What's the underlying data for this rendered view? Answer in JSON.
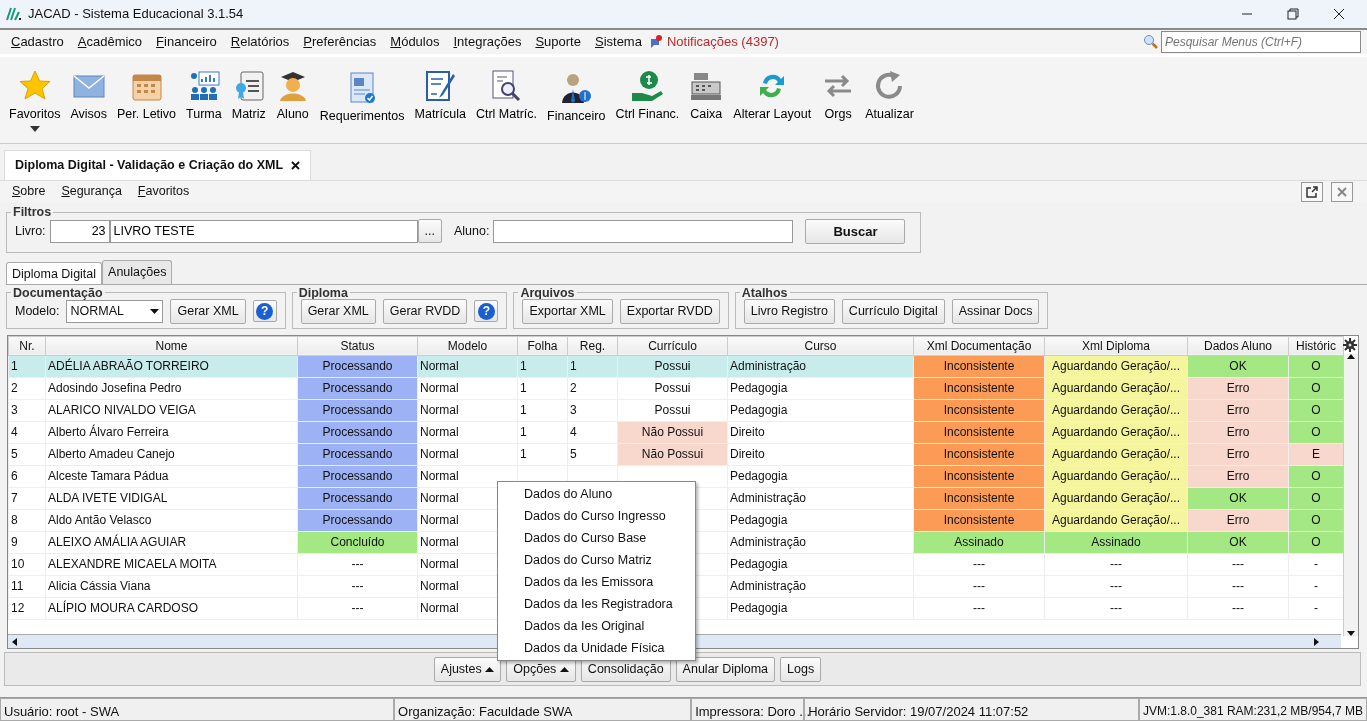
{
  "window": {
    "title": "JACAD - Sistema Educacional 3.1.54"
  },
  "menu": [
    "Cadastro",
    "Acadêmico",
    "Financeiro",
    "Relatórios",
    "Preferências",
    "Módulos",
    "Integrações",
    "Suporte",
    "Sistema"
  ],
  "notifications": "Notificações (4397)",
  "menu_search": {
    "placeholder": "Pesquisar Menus (Ctrl+F)"
  },
  "toolbar": [
    {
      "label": "Favoritos",
      "dropdown": true
    },
    {
      "label": "Avisos",
      "dropdown": false
    },
    {
      "label": "Per. Letivo",
      "dropdown": false
    },
    {
      "label": "Turma",
      "dropdown": false
    },
    {
      "label": "Matriz",
      "dropdown": false
    },
    {
      "label": "Aluno",
      "dropdown": false
    },
    {
      "label": "Requerimentos",
      "dropdown": false
    },
    {
      "label": "Matrícula",
      "dropdown": false
    },
    {
      "label": "Ctrl Matríc.",
      "dropdown": false
    },
    {
      "label": "Financeiro",
      "dropdown": false
    },
    {
      "label": "Ctrl Financ.",
      "dropdown": false
    },
    {
      "label": "Caixa",
      "dropdown": false
    },
    {
      "label": "Alterar Layout",
      "dropdown": false
    },
    {
      "label": "Orgs",
      "dropdown": false
    },
    {
      "label": "Atualizar",
      "dropdown": false
    }
  ],
  "document_tab": {
    "title": "Diploma Digital - Validação e Criação do XML"
  },
  "screen_menu": [
    "Sobre",
    "Segurança",
    "Favoritos"
  ],
  "filters": {
    "title": "Filtros",
    "livro_label": "Livro:",
    "livro_code": "23",
    "livro_name": "LIVRO TESTE",
    "browse_button": "...",
    "aluno_label": "Aluno:",
    "search_button": "Buscar"
  },
  "tabs": [
    {
      "label": "Diploma Digital",
      "selected": true
    },
    {
      "label": "Anulações",
      "selected": false
    }
  ],
  "groups": [
    {
      "title": "Documentação",
      "model_label": "Modelo:",
      "model_value": "NORMAL",
      "buttons": [
        "Gerar XML"
      ],
      "help": "?"
    },
    {
      "title": "Diploma",
      "buttons": [
        "Gerar XML",
        "Gerar RVDD"
      ],
      "help": "?"
    },
    {
      "title": "Arquivos",
      "buttons": [
        "Exportar XML",
        "Exportar RVDD"
      ]
    },
    {
      "title": "Atalhos",
      "buttons": [
        "Livro Registro",
        "Currículo Digital",
        "Assinar Docs"
      ]
    }
  ],
  "table": {
    "columns": [
      "Nr.",
      "Nome",
      "Status",
      "Modelo",
      "Folha",
      "Reg.",
      "Currículo",
      "Curso",
      "Xml Documentação",
      "Xml Diploma",
      "Dados Aluno",
      "Históric"
    ],
    "rows": [
      {
        "selected": true,
        "cells": [
          {
            "text": "1"
          },
          {
            "text": "ADÉLIA ABRAÃO TORREIRO"
          },
          {
            "text": "Processando",
            "color": "#9db2f4"
          },
          {
            "text": "Normal"
          },
          {
            "text": "1"
          },
          {
            "text": "1"
          },
          {
            "text": "Possui"
          },
          {
            "text": "Administração"
          },
          {
            "text": "Inconsistente",
            "color": "#fb9b55"
          },
          {
            "text": "Aguardando Geração/...",
            "color": "#f4f59c"
          },
          {
            "text": "OK",
            "color": "#a3e882"
          },
          {
            "text": "O",
            "color": "#a3e882"
          }
        ]
      },
      {
        "selected": false,
        "cells": [
          {
            "text": "2"
          },
          {
            "text": "Adosindo Josefina Pedro"
          },
          {
            "text": "Processando",
            "color": "#9db2f4"
          },
          {
            "text": "Normal"
          },
          {
            "text": "1"
          },
          {
            "text": "2"
          },
          {
            "text": "Possui"
          },
          {
            "text": "Pedagogia"
          },
          {
            "text": "Inconsistente",
            "color": "#fb9b55"
          },
          {
            "text": "Aguardando Geração/...",
            "color": "#f4f59c"
          },
          {
            "text": "Erro",
            "color": "#f8d7cd"
          },
          {
            "text": "O",
            "color": "#a3e882"
          }
        ]
      },
      {
        "selected": false,
        "cells": [
          {
            "text": "3"
          },
          {
            "text": "ALARICO NIVALDO VEIGA"
          },
          {
            "text": "Processando",
            "color": "#9db2f4"
          },
          {
            "text": "Normal"
          },
          {
            "text": "1"
          },
          {
            "text": "3"
          },
          {
            "text": "Possui"
          },
          {
            "text": "Pedagogia"
          },
          {
            "text": "Inconsistente",
            "color": "#fb9b55"
          },
          {
            "text": "Aguardando Geração/...",
            "color": "#f4f59c"
          },
          {
            "text": "Erro",
            "color": "#f8d7cd"
          },
          {
            "text": "O",
            "color": "#a3e882"
          }
        ]
      },
      {
        "selected": false,
        "cells": [
          {
            "text": "4"
          },
          {
            "text": "Alberto Álvaro Ferreira"
          },
          {
            "text": "Processando",
            "color": "#9db2f4"
          },
          {
            "text": "Normal"
          },
          {
            "text": "1"
          },
          {
            "text": "4"
          },
          {
            "text": "Não Possui",
            "color": "#f8d7cd"
          },
          {
            "text": "Direito"
          },
          {
            "text": "Inconsistente",
            "color": "#fb9b55"
          },
          {
            "text": "Aguardando Geração/...",
            "color": "#f4f59c"
          },
          {
            "text": "Erro",
            "color": "#f8d7cd"
          },
          {
            "text": "O",
            "color": "#a3e882"
          }
        ]
      },
      {
        "selected": false,
        "cells": [
          {
            "text": "5"
          },
          {
            "text": "Alberto Amadeu Canejo"
          },
          {
            "text": "Processando",
            "color": "#9db2f4"
          },
          {
            "text": "Normal"
          },
          {
            "text": "1"
          },
          {
            "text": "5"
          },
          {
            "text": "Não Possui",
            "color": "#f8d7cd"
          },
          {
            "text": "Direito"
          },
          {
            "text": "Inconsistente",
            "color": "#fb9b55"
          },
          {
            "text": "Aguardando Geração/...",
            "color": "#f4f59c"
          },
          {
            "text": "Erro",
            "color": "#f8d7cd"
          },
          {
            "text": "E",
            "color": "#f8d7cd"
          }
        ]
      },
      {
        "selected": false,
        "cells": [
          {
            "text": "6"
          },
          {
            "text": "Alceste Tamara Pádua"
          },
          {
            "text": "Processando",
            "color": "#9db2f4"
          },
          {
            "text": "Normal"
          },
          null,
          null,
          null,
          {
            "text": "Pedagogia"
          },
          {
            "text": "Inconsistente",
            "color": "#fb9b55"
          },
          {
            "text": "Aguardando Geração/...",
            "color": "#f4f59c"
          },
          {
            "text": "Erro",
            "color": "#f8d7cd"
          },
          {
            "text": "O",
            "color": "#a3e882"
          }
        ]
      },
      {
        "selected": false,
        "cells": [
          {
            "text": "7"
          },
          {
            "text": "ALDA IVETE VIDIGAL"
          },
          {
            "text": "Processando",
            "color": "#9db2f4"
          },
          {
            "text": "Normal"
          },
          null,
          null,
          null,
          {
            "text": "Administração"
          },
          {
            "text": "Inconsistente",
            "color": "#fb9b55"
          },
          {
            "text": "Aguardando Geração/...",
            "color": "#f4f59c"
          },
          {
            "text": "OK",
            "color": "#a3e882"
          },
          {
            "text": "O",
            "color": "#a3e882"
          }
        ]
      },
      {
        "selected": false,
        "cells": [
          {
            "text": "8"
          },
          {
            "text": "Aldo Antão Velasco"
          },
          {
            "text": "Processando",
            "color": "#9db2f4"
          },
          {
            "text": "Normal"
          },
          null,
          null,
          null,
          {
            "text": "Pedagogia"
          },
          {
            "text": "Inconsistente",
            "color": "#fb9b55"
          },
          {
            "text": "Aguardando Geração/...",
            "color": "#f4f59c"
          },
          {
            "text": "Erro",
            "color": "#f8d7cd"
          },
          {
            "text": "O",
            "color": "#a3e882"
          }
        ]
      },
      {
        "selected": false,
        "cells": [
          {
            "text": "9"
          },
          {
            "text": "ALEIXO AMÁLIA AGUIAR"
          },
          {
            "text": "Concluído",
            "color": "#a3e882"
          },
          {
            "text": "Normal"
          },
          null,
          null,
          null,
          {
            "text": "Administração"
          },
          {
            "text": "Assinado",
            "color": "#a3e882"
          },
          {
            "text": "Assinado",
            "color": "#a3e882"
          },
          {
            "text": "OK",
            "color": "#a3e882"
          },
          {
            "text": "O",
            "color": "#a3e882"
          }
        ]
      },
      {
        "selected": false,
        "cells": [
          {
            "text": "10"
          },
          {
            "text": "ALEXANDRE MICAELA MOITA"
          },
          {
            "text": "---"
          },
          {
            "text": "Normal"
          },
          null,
          null,
          null,
          {
            "text": "Pedagogia"
          },
          {
            "text": "---"
          },
          {
            "text": "---"
          },
          {
            "text": "---"
          },
          {
            "text": "-"
          }
        ]
      },
      {
        "selected": false,
        "cells": [
          {
            "text": "11"
          },
          {
            "text": "Alicia Cássia Viana"
          },
          {
            "text": "---"
          },
          {
            "text": "Normal"
          },
          null,
          null,
          null,
          {
            "text": "Administração"
          },
          {
            "text": "---"
          },
          {
            "text": "---"
          },
          {
            "text": "---"
          },
          {
            "text": "-"
          }
        ]
      },
      {
        "selected": false,
        "cells": [
          {
            "text": "12"
          },
          {
            "text": "ALÍPIO MOURA CARDOSO"
          },
          {
            "text": "---"
          },
          {
            "text": "Normal"
          },
          null,
          null,
          null,
          {
            "text": "Pedagogia"
          },
          {
            "text": "---"
          },
          {
            "text": "---"
          },
          {
            "text": "---"
          },
          {
            "text": "-"
          }
        ]
      }
    ]
  },
  "context_menu": [
    "Dados do Aluno",
    "Dados do Curso Ingresso",
    "Dados do Curso Base",
    "Dados do Curso Matriz",
    "Dados da Ies Emissora",
    "Dados da Ies Registradora",
    "Dados da Ies Original",
    "Dados da Unidade Física"
  ],
  "actions": [
    {
      "label": "Ajustes",
      "dropdown": true
    },
    {
      "label": "Opções",
      "dropdown": true
    },
    {
      "label": "Consolidação",
      "dropdown": false
    },
    {
      "label": "Anular Diploma",
      "dropdown": false
    },
    {
      "label": "Logs",
      "dropdown": false
    }
  ],
  "status_bar": [
    "Usuário: root - SWA",
    "Organização: Faculdade SWA",
    "Impressora: Doro ...",
    "Horário Servidor: 19/07/2024 11:07:52",
    "JVM:1.8.0_381  RAM:231,2 MB/954,7 MB"
  ]
}
